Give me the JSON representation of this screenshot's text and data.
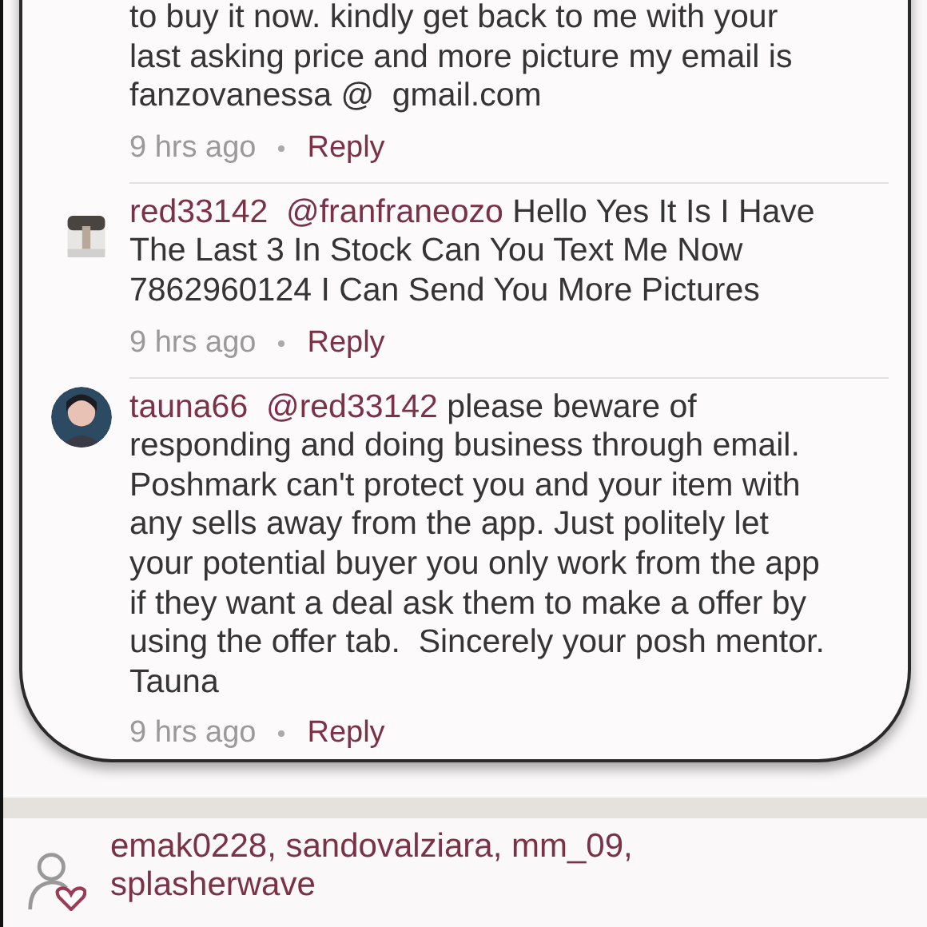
{
  "comments": [
    {
      "kind": "no-avatar",
      "text": "to buy it now. kindly get back to me with your\nlast asking price and more picture my email is\nfanzovanessa @  gmail.com",
      "time": "9 hrs ago",
      "reply": "Reply"
    },
    {
      "user": "red33142",
      "mention": "@franfraneozo",
      "kind": "square-avatar",
      "text": "Hello Yes It Is I Have\nThe Last 3 In Stock Can You Text Me Now\n7862960124 I Can Send You More Pictures",
      "time": "9 hrs ago",
      "reply": "Reply"
    },
    {
      "user": "tauna66",
      "mention": "@red33142",
      "kind": "round-avatar",
      "text": "please beware of\nresponding and doing business through email.\nPoshmark can't protect you and your item with\nany sells away from the app. Just politely let\nyour potential buyer you only work from the app\nif they want a deal ask them to make a offer by\nusing the offer tab.  Sincerely your posh mentor.\nTauna",
      "time": "9 hrs ago",
      "reply": "Reply"
    }
  ],
  "likes": {
    "users": "emak0228, sandovalziara, mm_09,\nsplasherwave"
  }
}
